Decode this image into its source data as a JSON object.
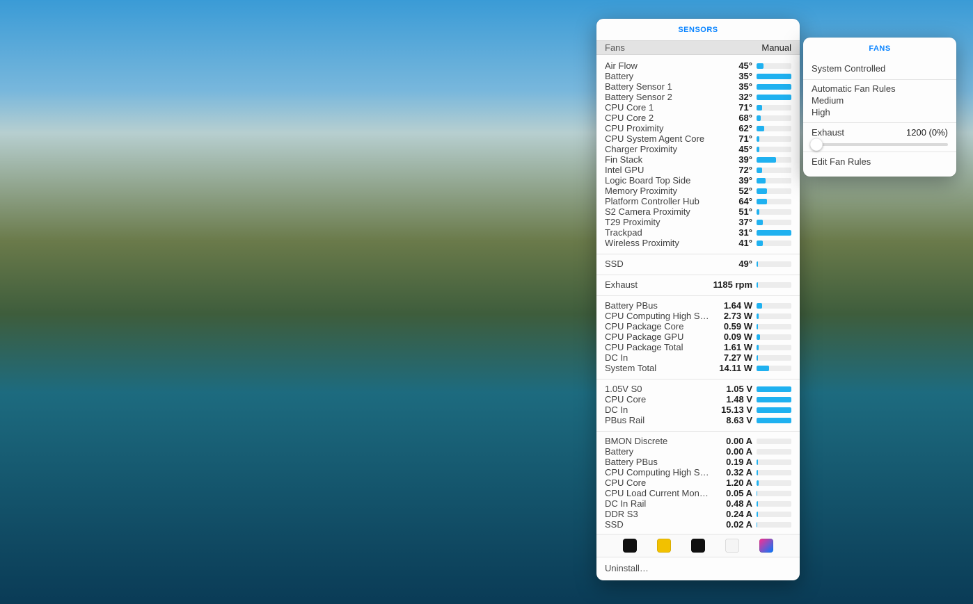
{
  "sensors_panel": {
    "title": "SENSORS",
    "header_left": "Fans",
    "header_right": "Manual",
    "bar_color": "#1fb1f0",
    "groups": [
      {
        "id": "temps",
        "rows": [
          {
            "label": "Air Flow",
            "value": "45°",
            "pct": 20
          },
          {
            "label": "Battery",
            "value": "35°",
            "pct": 100
          },
          {
            "label": "Battery Sensor 1",
            "value": "35°",
            "pct": 100
          },
          {
            "label": "Battery Sensor 2",
            "value": "32°",
            "pct": 100
          },
          {
            "label": "CPU Core 1",
            "value": "71°",
            "pct": 16
          },
          {
            "label": "CPU Core 2",
            "value": "68°",
            "pct": 12
          },
          {
            "label": "CPU Proximity",
            "value": "62°",
            "pct": 22
          },
          {
            "label": "CPU System Agent Core",
            "value": "71°",
            "pct": 8
          },
          {
            "label": "Charger Proximity",
            "value": "45°",
            "pct": 8
          },
          {
            "label": "Fin Stack",
            "value": "39°",
            "pct": 55
          },
          {
            "label": "Intel GPU",
            "value": "72°",
            "pct": 16
          },
          {
            "label": "Logic Board Top Side",
            "value": "39°",
            "pct": 25
          },
          {
            "label": "Memory Proximity",
            "value": "52°",
            "pct": 30
          },
          {
            "label": "Platform Controller Hub",
            "value": "64°",
            "pct": 30
          },
          {
            "label": "S2 Camera Proximity",
            "value": "51°",
            "pct": 8
          },
          {
            "label": "T29 Proximity",
            "value": "37°",
            "pct": 18
          },
          {
            "label": "Trackpad",
            "value": "31°",
            "pct": 100
          },
          {
            "label": "Wireless Proximity",
            "value": "41°",
            "pct": 18
          }
        ]
      },
      {
        "id": "storage_temp",
        "rows": [
          {
            "label": "SSD",
            "value": "49°",
            "pct": 4
          }
        ]
      },
      {
        "id": "fan_rpm",
        "rows": [
          {
            "label": "Exhaust",
            "value": "1185 rpm",
            "pct": 4
          }
        ]
      },
      {
        "id": "power",
        "rows": [
          {
            "label": "Battery PBus",
            "value": "1.64 W",
            "pct": 16
          },
          {
            "label": "CPU Computing High Side",
            "value": "2.73 W",
            "pct": 6
          },
          {
            "label": "CPU Package Core",
            "value": "0.59 W",
            "pct": 4
          },
          {
            "label": "CPU Package GPU",
            "value": "0.09 W",
            "pct": 10
          },
          {
            "label": "CPU Package Total",
            "value": "1.61 W",
            "pct": 6
          },
          {
            "label": "DC In",
            "value": "7.27 W",
            "pct": 4
          },
          {
            "label": "System Total",
            "value": "14.11 W",
            "pct": 35
          }
        ]
      },
      {
        "id": "voltage",
        "rows": [
          {
            "label": "1.05V S0",
            "value": "1.05 V",
            "pct": 100
          },
          {
            "label": "CPU Core",
            "value": "1.48 V",
            "pct": 100
          },
          {
            "label": "DC In",
            "value": "15.13 V",
            "pct": 100
          },
          {
            "label": "PBus Rail",
            "value": "8.63 V",
            "pct": 100
          }
        ]
      },
      {
        "id": "current",
        "rows": [
          {
            "label": "BMON Discrete",
            "value": "0.00 A",
            "pct": 0
          },
          {
            "label": "Battery",
            "value": "0.00 A",
            "pct": 0
          },
          {
            "label": "Battery PBus",
            "value": "0.19 A",
            "pct": 4
          },
          {
            "label": "CPU Computing High Side",
            "value": "0.32 A",
            "pct": 4
          },
          {
            "label": "CPU Core",
            "value": "1.20 A",
            "pct": 6
          },
          {
            "label": "CPU Load Current Monitor",
            "value": "0.05 A",
            "pct": 2
          },
          {
            "label": "DC In Rail",
            "value": "0.48 A",
            "pct": 4
          },
          {
            "label": "DDR S3",
            "value": "0.24 A",
            "pct": 4
          },
          {
            "label": "SSD",
            "value": "0.02 A",
            "pct": 2
          }
        ]
      }
    ],
    "toolbar_icons": [
      {
        "name": "activity-monitor-icon",
        "bg": "#101010"
      },
      {
        "name": "console-icon",
        "bg": "#f2c100"
      },
      {
        "name": "terminal-icon",
        "bg": "#101010"
      },
      {
        "name": "system-info-icon",
        "bg": "#f5f5f5"
      },
      {
        "name": "apple-diagnostics-icon",
        "bg": "linear-gradient(135deg,#ff2d8f,#007aff)"
      }
    ],
    "uninstall_label": "Uninstall…"
  },
  "fans_panel": {
    "title": "FANS",
    "system_controlled": "System Controlled",
    "rules": {
      "heading": "Automatic Fan Rules",
      "items": [
        "Medium",
        "High"
      ]
    },
    "fan": {
      "label": "Exhaust",
      "value": "1200 (0%)",
      "slider_pct": 0
    },
    "edit_rules": "Edit Fan Rules"
  }
}
